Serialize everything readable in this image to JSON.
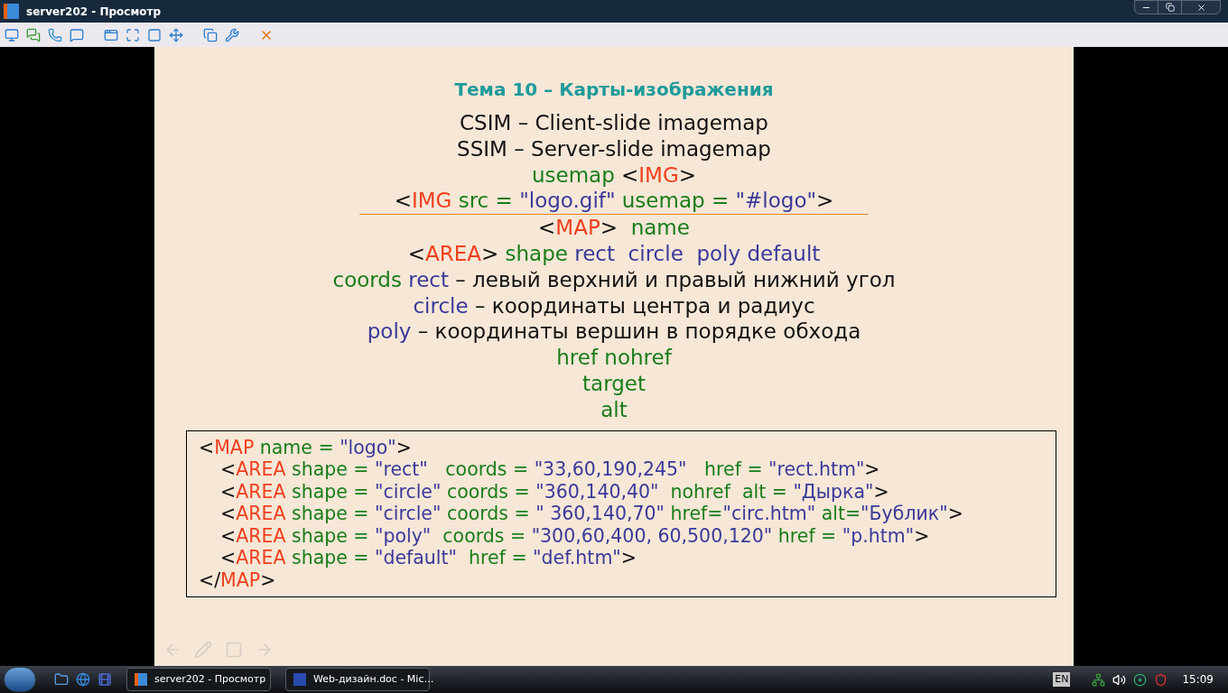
{
  "window": {
    "title": "server202 - Просмотр"
  },
  "slide": {
    "title": "Тема 10 – Карты-изображения",
    "lines": [
      {
        "segments": [
          {
            "kind": "text",
            "text": "CSIM – Client-slide imagemap"
          }
        ]
      },
      {
        "segments": [
          {
            "kind": "text",
            "text": "SSIM – Server-slide imagemap"
          }
        ]
      },
      {
        "segments": [
          {
            "kind": "keyword",
            "text": "usemap "
          },
          {
            "kind": "text",
            "text": "<"
          },
          {
            "kind": "tag",
            "text": "IMG"
          },
          {
            "kind": "text",
            "text": ">"
          }
        ]
      },
      {
        "segments": [
          {
            "kind": "text",
            "text": "<"
          },
          {
            "kind": "tag",
            "text": "IMG"
          },
          {
            "kind": "keyword",
            "text": " src = "
          },
          {
            "kind": "value",
            "text": "\"logo.gif\""
          },
          {
            "kind": "keyword",
            "text": " usemap = "
          },
          {
            "kind": "value",
            "text": "\"#logo\""
          },
          {
            "kind": "text",
            "text": ">"
          }
        ],
        "rule_below": true
      },
      {
        "segments": [
          {
            "kind": "text",
            "text": "<"
          },
          {
            "kind": "tag",
            "text": "MAP"
          },
          {
            "kind": "text",
            "text": ">  "
          },
          {
            "kind": "keyword",
            "text": "name"
          }
        ]
      },
      {
        "segments": [
          {
            "kind": "text",
            "text": "<"
          },
          {
            "kind": "tag",
            "text": "AREA"
          },
          {
            "kind": "text",
            "text": "> "
          },
          {
            "kind": "keyword",
            "text": "shape "
          },
          {
            "kind": "value",
            "text": "rect  circle  poly default"
          }
        ]
      },
      {
        "segments": [
          {
            "kind": "keyword",
            "text": "coords "
          },
          {
            "kind": "value",
            "text": "rect"
          },
          {
            "kind": "text",
            "text": " – левый верхний и правый нижний угол"
          }
        ]
      },
      {
        "segments": [
          {
            "kind": "value",
            "text": "circle"
          },
          {
            "kind": "text",
            "text": " – координаты центра и радиус"
          }
        ]
      },
      {
        "segments": [
          {
            "kind": "value",
            "text": "poly"
          },
          {
            "kind": "text",
            "text": " – координаты вершин в порядке обхода"
          }
        ]
      },
      {
        "segments": [
          {
            "kind": "keyword",
            "text": "href nohref"
          }
        ]
      },
      {
        "segments": [
          {
            "kind": "keyword",
            "text": "target"
          }
        ]
      },
      {
        "segments": [
          {
            "kind": "keyword",
            "text": "alt"
          }
        ]
      }
    ],
    "code": [
      {
        "segments": [
          {
            "kind": "text",
            "text": "<"
          },
          {
            "kind": "tag",
            "text": "MAP"
          },
          {
            "kind": "keyword",
            "text": " name = "
          },
          {
            "kind": "value",
            "text": "\"logo\""
          },
          {
            "kind": "text",
            "text": ">"
          }
        ],
        "children": [
          {
            "segments": [
              {
                "kind": "text",
                "text": "<"
              },
              {
                "kind": "tag",
                "text": "AREA"
              },
              {
                "kind": "keyword",
                "text": " shape = "
              },
              {
                "kind": "value",
                "text": "\"rect\""
              },
              {
                "kind": "keyword",
                "text": "   coords = "
              },
              {
                "kind": "value",
                "text": "\"33,60,190,245\""
              },
              {
                "kind": "keyword",
                "text": "   href = "
              },
              {
                "kind": "value",
                "text": "\"rect.htm\""
              },
              {
                "kind": "text",
                "text": ">"
              }
            ]
          },
          {
            "segments": [
              {
                "kind": "text",
                "text": "<"
              },
              {
                "kind": "tag",
                "text": "AREA"
              },
              {
                "kind": "keyword",
                "text": " shape = "
              },
              {
                "kind": "value",
                "text": "\"circle\""
              },
              {
                "kind": "keyword",
                "text": " coords = "
              },
              {
                "kind": "value",
                "text": "\"360,140,40\""
              },
              {
                "kind": "keyword",
                "text": "  nohref  alt = "
              },
              {
                "kind": "value",
                "text": "\"Дырка\""
              },
              {
                "kind": "text",
                "text": ">"
              }
            ]
          },
          {
            "segments": [
              {
                "kind": "text",
                "text": "<"
              },
              {
                "kind": "tag",
                "text": "AREA"
              },
              {
                "kind": "keyword",
                "text": " shape = "
              },
              {
                "kind": "value",
                "text": "\"circle\""
              },
              {
                "kind": "keyword",
                "text": " coords = "
              },
              {
                "kind": "value",
                "text": "\" 360,140,70\""
              },
              {
                "kind": "keyword",
                "text": " href="
              },
              {
                "kind": "value",
                "text": "\"circ.htm\""
              },
              {
                "kind": "keyword",
                "text": " alt="
              },
              {
                "kind": "value",
                "text": "\"Бублик\""
              },
              {
                "kind": "text",
                "text": ">"
              }
            ]
          },
          {
            "segments": [
              {
                "kind": "text",
                "text": "<"
              },
              {
                "kind": "tag",
                "text": "AREA"
              },
              {
                "kind": "keyword",
                "text": " shape = "
              },
              {
                "kind": "value",
                "text": "\"poly\""
              },
              {
                "kind": "keyword",
                "text": "  coords = "
              },
              {
                "kind": "value",
                "text": "\"300,60,400, 60,500,120\""
              },
              {
                "kind": "keyword",
                "text": " href = "
              },
              {
                "kind": "value",
                "text": "\"p.htm\""
              },
              {
                "kind": "text",
                "text": ">"
              }
            ]
          },
          {
            "segments": [
              {
                "kind": "text",
                "text": "<"
              },
              {
                "kind": "tag",
                "text": "AREA"
              },
              {
                "kind": "keyword",
                "text": " shape = "
              },
              {
                "kind": "value",
                "text": "\"default\""
              },
              {
                "kind": "keyword",
                "text": "  href = "
              },
              {
                "kind": "value",
                "text": "\"def.htm\""
              },
              {
                "kind": "text",
                "text": ">"
              }
            ]
          }
        ]
      },
      {
        "segments": [
          {
            "kind": "text",
            "text": "</"
          },
          {
            "kind": "tag",
            "text": "MAP"
          },
          {
            "kind": "text",
            "text": ">"
          }
        ]
      }
    ]
  },
  "taskbar": {
    "tasks": [
      {
        "kind": "viewer",
        "label": "server202 - Просмотр"
      },
      {
        "kind": "word",
        "label": "Web-дизайн.doc - Mic…"
      }
    ],
    "language": "EN",
    "clock": "15:09"
  }
}
